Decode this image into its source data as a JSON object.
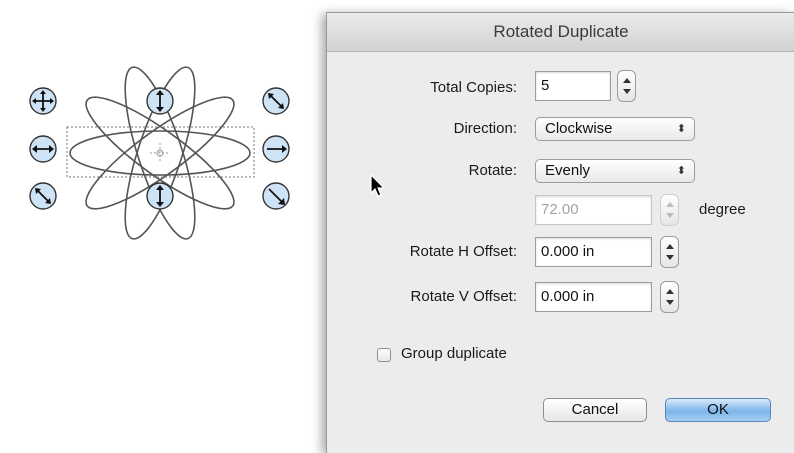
{
  "dialog": {
    "title": "Rotated Duplicate",
    "total_copies": {
      "label": "Total Copies:",
      "value": "5"
    },
    "direction": {
      "label": "Direction:",
      "value": "Clockwise"
    },
    "rotate": {
      "label": "Rotate:",
      "value": "Evenly"
    },
    "angle": {
      "value": "72.00",
      "unit": "degree"
    },
    "h_offset": {
      "label": "Rotate H Offset:",
      "value": "0.000 in"
    },
    "v_offset": {
      "label": "Rotate V Offset:",
      "value": "0.000 in"
    },
    "group_duplicate": {
      "label": "Group duplicate",
      "checked": false
    },
    "cancel_label": "Cancel",
    "ok_label": "OK"
  },
  "colors": {
    "handle_fill": "#cfe3f7",
    "default_button": "#7db5ea"
  },
  "icons": [
    "move-handle-icon",
    "resize-vertical-icon",
    "resize-horizontal-icon",
    "rotate-handle-icon",
    "diagonal-resize-icon",
    "pointer-cursor-icon"
  ]
}
